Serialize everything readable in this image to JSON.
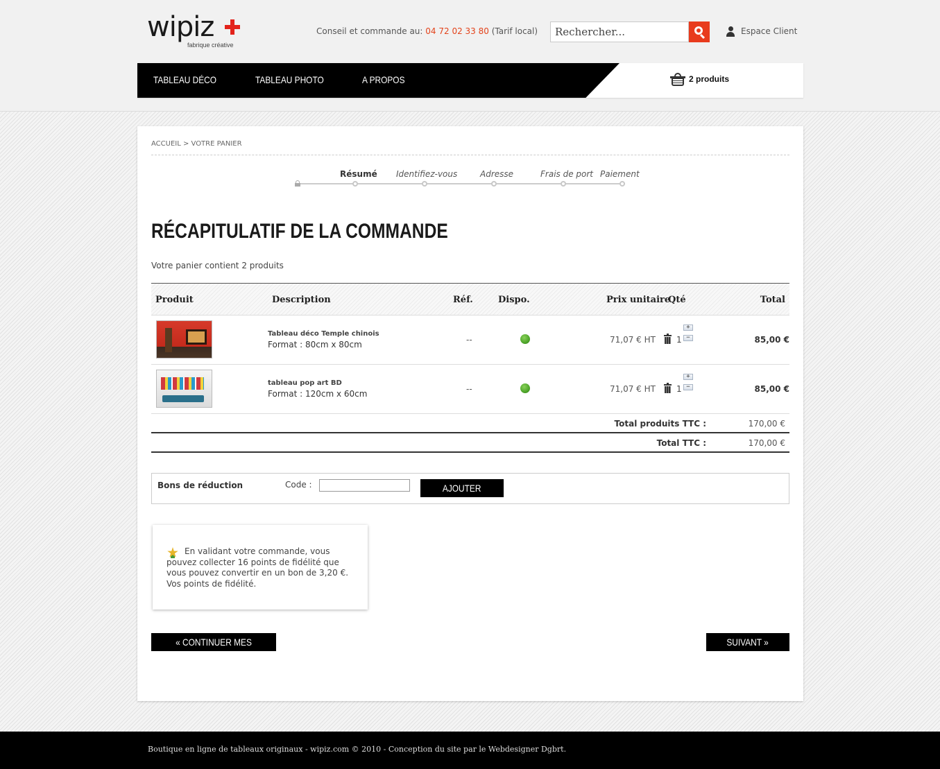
{
  "brand": {
    "name": "wipiz",
    "tagline": "fabrique créative"
  },
  "header": {
    "contact_label": "Conseil et commande au:",
    "phone": "04 72 02 33 80",
    "phone_note": "(Tarif local)",
    "search_placeholder": "Rechercher...",
    "account_label": "Espace Client"
  },
  "nav": {
    "items": [
      {
        "label": "TABLEAU DÉCO"
      },
      {
        "label": "TABLEAU PHOTO"
      },
      {
        "label": "A PROPOS"
      }
    ],
    "cart_label": "2 produits"
  },
  "breadcrumb": "ACCUEIL > VOTRE PANIER",
  "steps": [
    {
      "label": "Résumé",
      "active": true
    },
    {
      "label": "Identifiez-vous",
      "active": false
    },
    {
      "label": "Adresse",
      "active": false
    },
    {
      "label": "Frais de port",
      "active": false
    },
    {
      "label": "Paiement",
      "active": false
    }
  ],
  "page_title": "RÉCAPITULATIF DE LA COMMANDE",
  "cart_summary": "Votre panier contient 2 produits",
  "table": {
    "headers": {
      "product": "Produit",
      "description": "Description",
      "ref": "Réf.",
      "dispo": "Dispo.",
      "unit_price": "Prix unitaire",
      "qty": "Qté",
      "total": "Total"
    },
    "rows": [
      {
        "name": "Tableau déco Temple chinois",
        "format": "Format : 80cm x 80cm",
        "ref": "--",
        "unit_price": "71,07 € HT",
        "qty": "1",
        "total": "85,00 €"
      },
      {
        "name": "tableau pop art BD",
        "format": "Format : 120cm x 60cm",
        "ref": "--",
        "unit_price": "71,07 € HT",
        "qty": "1",
        "total": "85,00 €"
      }
    ],
    "qty_plus": "+",
    "qty_minus": "−",
    "total_products_label": "Total produits TTC :",
    "total_products_value": "170,00 €",
    "total_label": "Total TTC :",
    "total_value": "170,00 €"
  },
  "voucher": {
    "label": "Bons de réduction",
    "code_label": "Code :",
    "code_value": "",
    "button": "AJOUTER"
  },
  "loyalty": {
    "text": "En validant votre commande, vous pouvez collecter 16 points de fidélité que vous pouvez convertir en un bon de 3,20 €. Vos points de fidélité."
  },
  "buttons": {
    "back": "« CONTINUER MES ACHATS",
    "next": "SUIVANT »"
  },
  "footer": {
    "text": "Boutique en ligne de tableaux originaux - wipiz.com © 2010 - Conception du site par le Webdesigner Dgbrt."
  },
  "colors": {
    "accent": "#e3231b",
    "phone": "#e3431b",
    "nav_bg": "#000000",
    "availability_dot": "#4ea52a"
  }
}
